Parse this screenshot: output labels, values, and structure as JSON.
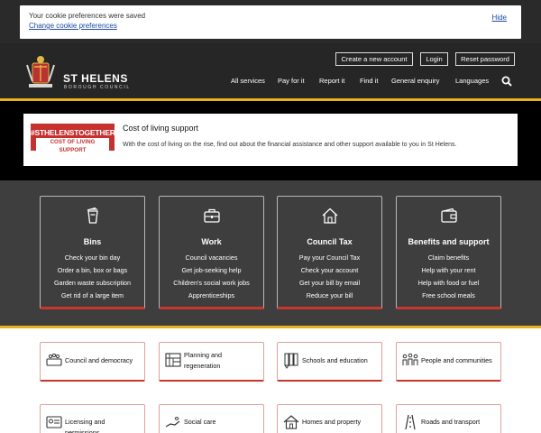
{
  "cookie": {
    "message": "Your cookie preferences were saved",
    "change_link": "Change cookie preferences",
    "hide_link": "Hide"
  },
  "header": {
    "brand_name": "ST HELENS",
    "brand_sub": "BOROUGH COUNCIL",
    "account_buttons": [
      "Create a new account",
      "Login",
      "Reset password"
    ],
    "nav": [
      "All services",
      "Pay for it",
      "Report it",
      "Find it",
      "General enquiry",
      "Languages"
    ]
  },
  "cost_of_living": {
    "badge_line1": "#STHELENSTOGETHER",
    "badge_line2": "COST OF LIVING SUPPORT",
    "title": "Cost of living support",
    "description": "With the cost of living on the rise, find out about the financial assistance and other support available to you in St Helens."
  },
  "services": [
    {
      "title": "Bins",
      "icon": "bin-icon",
      "links": [
        "Check your bin day",
        "Order a bin, box or bags",
        "Garden waste subscription",
        "Get rid of a large item"
      ]
    },
    {
      "title": "Work",
      "icon": "briefcase-icon",
      "links": [
        "Council vacancies",
        "Get job-seeking help",
        "Children's social work jobs",
        "Apprenticeships"
      ]
    },
    {
      "title": "Council Tax",
      "icon": "house-icon",
      "links": [
        "Pay your Council Tax",
        "Check your account",
        "Get your bill by email",
        "Reduce your bill"
      ]
    },
    {
      "title": "Benefits and support",
      "icon": "wallet-icon",
      "links": [
        "Claim benefits",
        "Help with your rent",
        "Help with food or fuel",
        "Free school meals"
      ]
    }
  ],
  "categories": [
    {
      "label": "Council and democracy",
      "icon": "council-chamber-icon"
    },
    {
      "label": "Planning and regeneration",
      "icon": "blueprint-icon"
    },
    {
      "label": "Schools and education",
      "icon": "pencils-icon"
    },
    {
      "label": "People and communities",
      "icon": "people-group-icon"
    },
    {
      "label": "Licensing and permissions",
      "icon": "license-card-icon"
    },
    {
      "label": "Social care",
      "icon": "caring-hand-icon"
    },
    {
      "label": "Homes and property",
      "icon": "home-property-icon"
    },
    {
      "label": "Roads and transport",
      "icon": "road-icon"
    }
  ],
  "colors": {
    "accent": "#e9b21b",
    "brand_red": "#c8362d",
    "header_bg": "#262626",
    "services_bg": "#3e3e3e"
  }
}
